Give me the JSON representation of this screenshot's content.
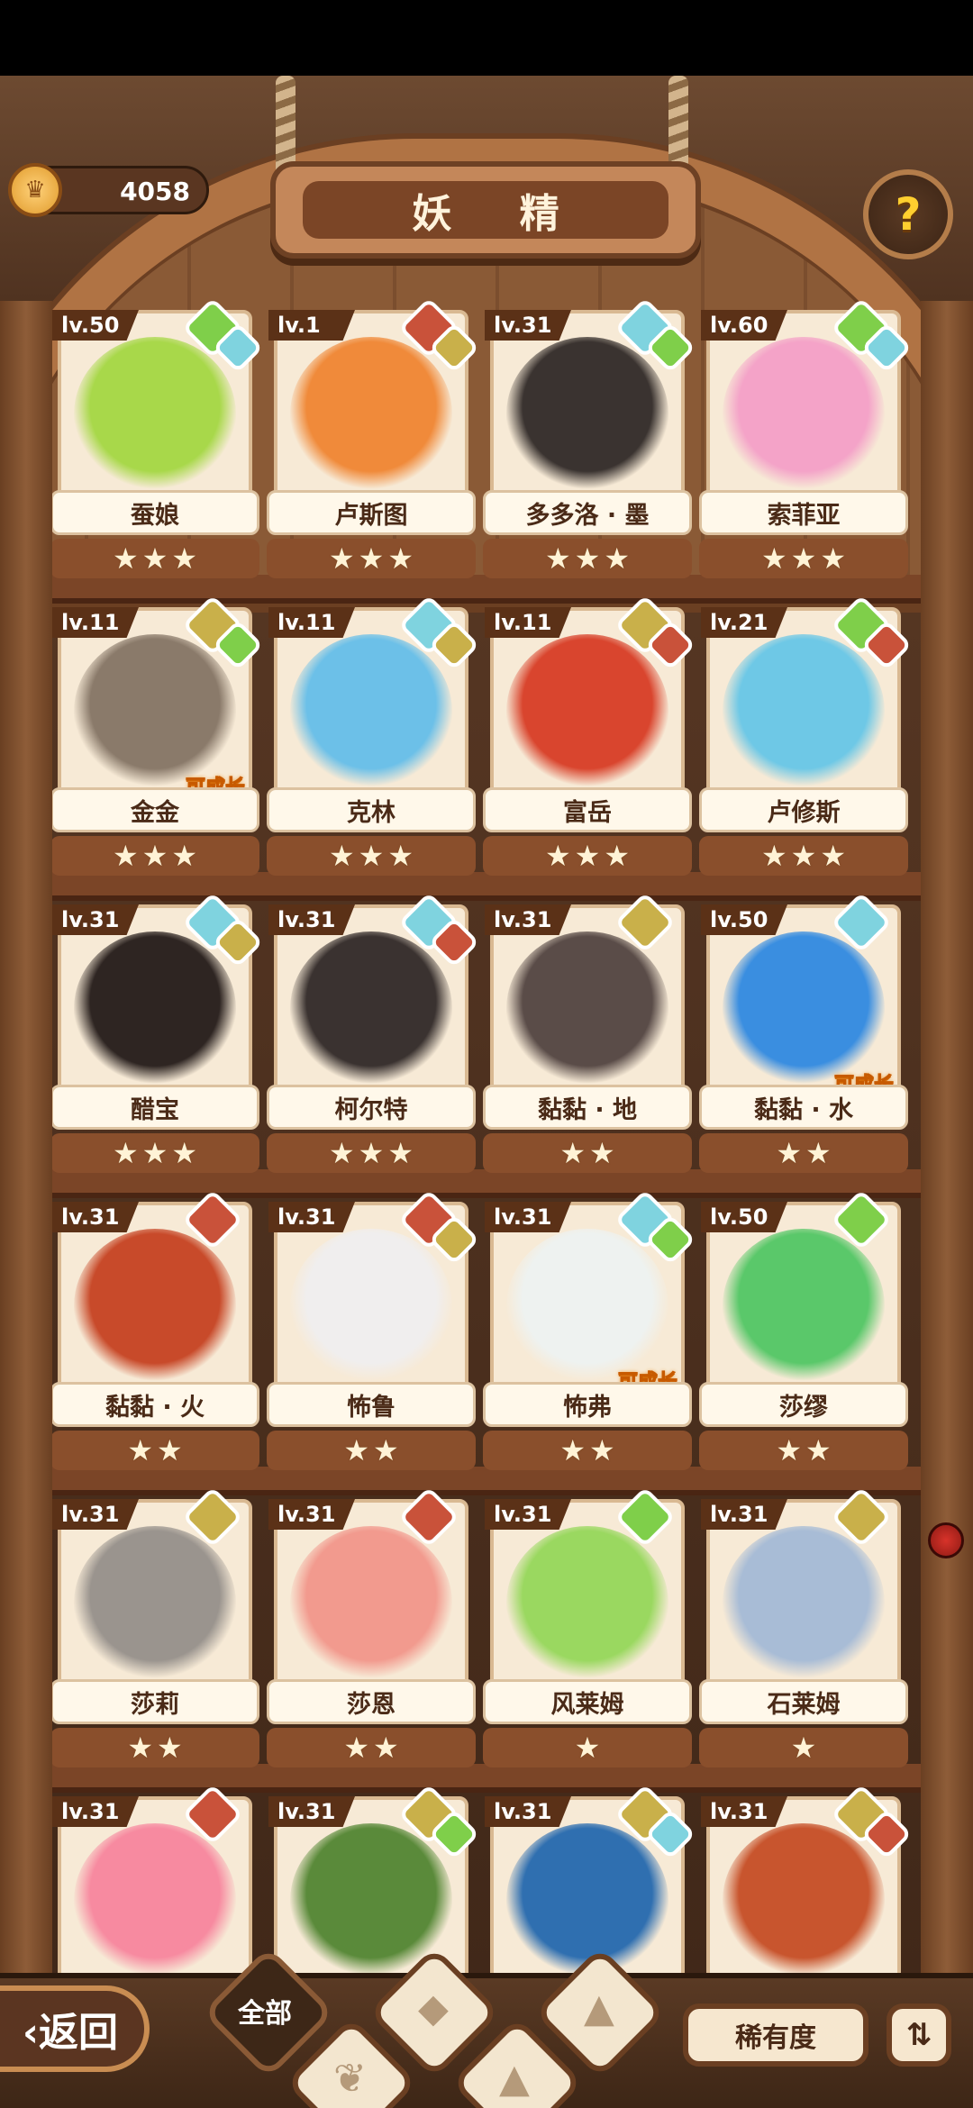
{
  "header": {
    "title": "妖 精",
    "currency_value": "4058",
    "help_symbol": "?"
  },
  "colors": {
    "leaf": "#7fcf4a",
    "water": "#7fd3df",
    "earth": "#c9b04a",
    "fire": "#c9523a",
    "stone": "#b7a58f"
  },
  "fairies": [
    {
      "level": "lv.50",
      "name": "蚕娘",
      "stars": 3,
      "elements": [
        "leaf",
        "water"
      ],
      "grow": "",
      "portrait": "#a8d84a"
    },
    {
      "level": "lv.1",
      "name": "卢斯图",
      "stars": 3,
      "elements": [
        "fire",
        "earth"
      ],
      "grow": "",
      "portrait": "#f08a3a"
    },
    {
      "level": "lv.31",
      "name": "多多洛 · 墨",
      "stars": 3,
      "elements": [
        "water",
        "leaf"
      ],
      "grow": "",
      "portrait": "#3a3330"
    },
    {
      "level": "lv.60",
      "name": "索菲亚",
      "stars": 3,
      "elements": [
        "leaf",
        "water"
      ],
      "grow": "",
      "portrait": "#f4a3c8"
    },
    {
      "level": "lv.11",
      "name": "金金",
      "stars": 3,
      "elements": [
        "earth",
        "leaf"
      ],
      "grow": "可成长",
      "portrait": "#8a7a6a"
    },
    {
      "level": "lv.11",
      "name": "克林",
      "stars": 3,
      "elements": [
        "water",
        "earth"
      ],
      "grow": "",
      "portrait": "#6cc0e8"
    },
    {
      "level": "lv.11",
      "name": "富岳",
      "stars": 3,
      "elements": [
        "earth",
        "fire"
      ],
      "grow": "",
      "portrait": "#d9452e"
    },
    {
      "level": "lv.21",
      "name": "卢修斯",
      "stars": 3,
      "elements": [
        "leaf",
        "fire"
      ],
      "grow": "",
      "portrait": "#6ec8e6"
    },
    {
      "level": "lv.31",
      "name": "醋宝",
      "stars": 3,
      "elements": [
        "water",
        "earth"
      ],
      "grow": "",
      "portrait": "#2e2522"
    },
    {
      "level": "lv.31",
      "name": "柯尔特",
      "stars": 3,
      "elements": [
        "water",
        "fire"
      ],
      "grow": "",
      "portrait": "#3a3230"
    },
    {
      "level": "lv.31",
      "name": "黏黏 · 地",
      "stars": 2,
      "elements": [
        "earth"
      ],
      "grow": "",
      "portrait": "#5a4c48"
    },
    {
      "level": "lv.50",
      "name": "黏黏 · 水",
      "stars": 2,
      "elements": [
        "water"
      ],
      "grow": "可成长",
      "portrait": "#3a8ee0"
    },
    {
      "level": "lv.31",
      "name": "黏黏 · 火",
      "stars": 2,
      "elements": [
        "fire"
      ],
      "grow": "",
      "portrait": "#c84a2a"
    },
    {
      "level": "lv.31",
      "name": "怖鲁",
      "stars": 2,
      "elements": [
        "fire",
        "earth"
      ],
      "grow": "",
      "portrait": "#f0eeee"
    },
    {
      "level": "lv.31",
      "name": "怖弗",
      "stars": 2,
      "elements": [
        "water",
        "leaf"
      ],
      "grow": "可成长",
      "portrait": "#eef2f0"
    },
    {
      "level": "lv.50",
      "name": "莎缪",
      "stars": 2,
      "elements": [
        "leaf"
      ],
      "grow": "",
      "portrait": "#5ac86a"
    },
    {
      "level": "lv.31",
      "name": "莎莉",
      "stars": 2,
      "elements": [
        "earth"
      ],
      "grow": "",
      "portrait": "#9a948e"
    },
    {
      "level": "lv.31",
      "name": "莎恩",
      "stars": 2,
      "elements": [
        "fire"
      ],
      "grow": "",
      "portrait": "#f29a8e"
    },
    {
      "level": "lv.31",
      "name": "风莱姆",
      "stars": 1,
      "elements": [
        "leaf"
      ],
      "grow": "",
      "portrait": "#9ad860"
    },
    {
      "level": "lv.31",
      "name": "石莱姆",
      "stars": 1,
      "elements": [
        "earth"
      ],
      "grow": "",
      "portrait": "#a8bcd6"
    },
    {
      "level": "lv.31",
      "name": "",
      "stars": 0,
      "elements": [
        "fire"
      ],
      "grow": "",
      "portrait": "#f78aa0"
    },
    {
      "level": "lv.31",
      "name": "",
      "stars": 0,
      "elements": [
        "earth",
        "leaf"
      ],
      "grow": "",
      "portrait": "#5a8a3a"
    },
    {
      "level": "lv.31",
      "name": "",
      "stars": 0,
      "elements": [
        "earth",
        "water"
      ],
      "grow": "",
      "portrait": "#2f6fb0"
    },
    {
      "level": "lv.31",
      "name": "",
      "stars": 0,
      "elements": [
        "earth",
        "fire"
      ],
      "grow": "",
      "portrait": "#c8552e"
    }
  ],
  "footer": {
    "back_label": "‹返回",
    "tab_all_label": "全部",
    "rarity_label": "稀有度",
    "sort_icon": "⇅"
  }
}
